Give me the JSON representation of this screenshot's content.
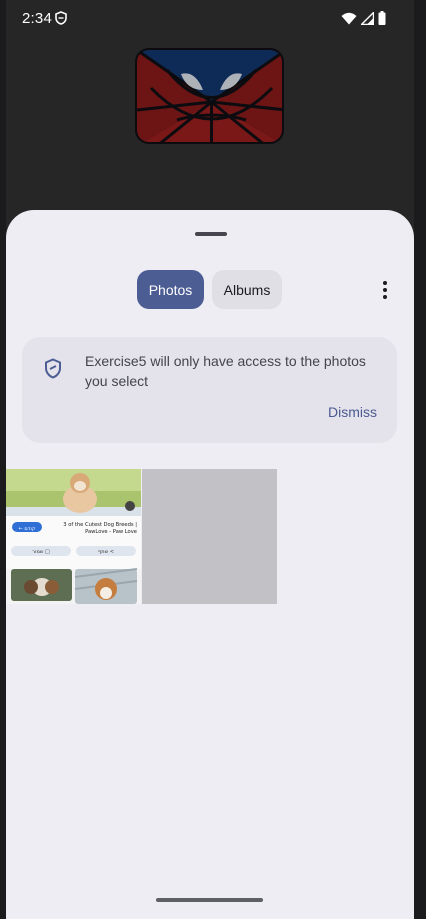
{
  "status_bar": {
    "time": "2:34",
    "icons": [
      "privacy-shield-icon",
      "wifi-icon",
      "signal-icon",
      "battery-icon"
    ]
  },
  "app_logo": {
    "icon": "spider-web-logo",
    "colors": {
      "background": "#111216",
      "web": "#0c0c10",
      "red": "#8a1a1a",
      "blue": "#0e2b58"
    }
  },
  "picker": {
    "tabs": [
      {
        "label": "Photos",
        "selected": true
      },
      {
        "label": "Albums",
        "selected": false
      }
    ],
    "overflow_icon": "more-vert-icon",
    "banner": {
      "icon": "shield-icon",
      "message": "Exercise5 will only have access to the photos you select",
      "dismiss_label": "Dismiss"
    },
    "photos": [
      {
        "type": "screenshot",
        "contents": {
          "headline": "3 of the Cutest Dog Breeds | PawLove - Paw Love",
          "button_label": "← קודם",
          "chip_1": "שמור □",
          "chip_2": "שתף <"
        }
      },
      {
        "type": "placeholder"
      }
    ]
  },
  "colors": {
    "accent": "#4c5d94",
    "sheet_bg": "#eeedf3",
    "banner_bg": "#e4e3ec",
    "link": "#4b5a8f"
  }
}
